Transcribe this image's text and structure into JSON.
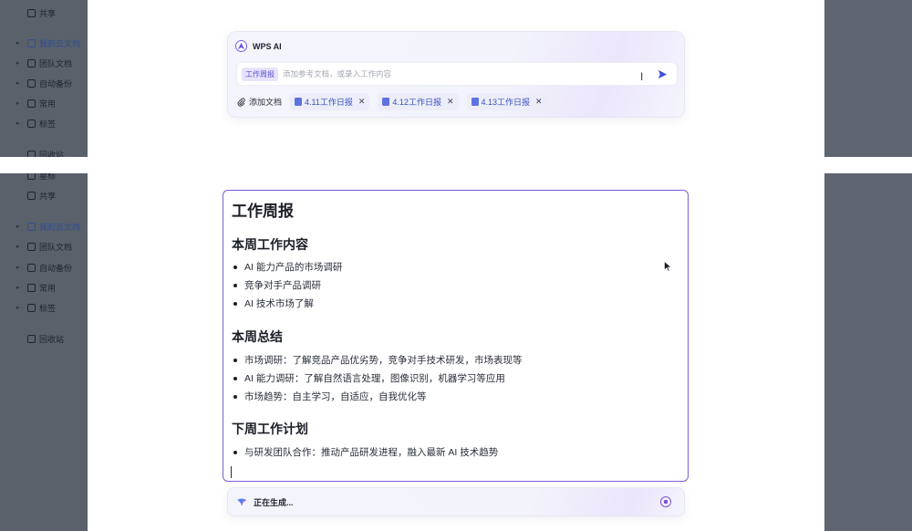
{
  "sidebar_top": {
    "items": [
      {
        "label": "共享",
        "icon": "share-icon",
        "caret": false
      },
      {
        "label": "我的云文档",
        "icon": "folder-icon",
        "caret": true,
        "highlight": true
      },
      {
        "label": "团队文档",
        "icon": "team-icon",
        "caret": true
      },
      {
        "label": "自动备份",
        "icon": "cloud-icon",
        "caret": true
      },
      {
        "label": "常用",
        "icon": "star-icon",
        "caret": true
      },
      {
        "label": "标签",
        "icon": "tag-icon",
        "caret": true
      },
      {
        "label": "回收站",
        "icon": "trash-icon",
        "caret": false
      }
    ]
  },
  "sidebar_bottom": {
    "items": [
      {
        "label": "星标",
        "icon": "star-icon",
        "caret": false
      },
      {
        "label": "共享",
        "icon": "share-icon",
        "caret": false
      },
      {
        "label": "我的云文档",
        "icon": "folder-icon",
        "caret": true,
        "highlight": true
      },
      {
        "label": "团队文档",
        "icon": "team-icon",
        "caret": true
      },
      {
        "label": "自动备份",
        "icon": "cloud-icon",
        "caret": true
      },
      {
        "label": "常用",
        "icon": "star-icon",
        "caret": true
      },
      {
        "label": "标签",
        "icon": "tag-icon",
        "caret": true
      },
      {
        "label": "回收站",
        "icon": "trash-icon",
        "caret": false
      }
    ]
  },
  "ai_panel": {
    "title": "WPS AI",
    "input": {
      "tag": "工作周报",
      "placeholder": "添加参考文档，或录入工作内容"
    },
    "add_doc_label": "添加文档",
    "attachments": [
      "4.11工作日报",
      "4.12工作日报",
      "4.13工作日报"
    ]
  },
  "document": {
    "title": "工作周报",
    "sections": [
      {
        "heading": "本周工作内容",
        "items": [
          "AI 能力产品的市场调研",
          "竞争对手产品调研",
          "AI 技术市场了解"
        ]
      },
      {
        "heading": "本周总结",
        "items": [
          "市场调研：了解竞品产品优劣势，竞争对手技术研发，市场表现等",
          "AI 能力调研：了解自然语言处理，图像识别，机器学习等应用",
          "市场趋势：自主学习，自适应，自我优化等"
        ]
      },
      {
        "heading": "下周工作计划",
        "items": [
          "与研发团队合作：推动产品研发进程，融入最新 AI 技术趋势"
        ]
      }
    ]
  },
  "generating": {
    "status": "正在生成..."
  },
  "colors": {
    "accent": "#7d5cdc",
    "chip_text": "#3c54b8",
    "overlay": "#5f6570"
  }
}
